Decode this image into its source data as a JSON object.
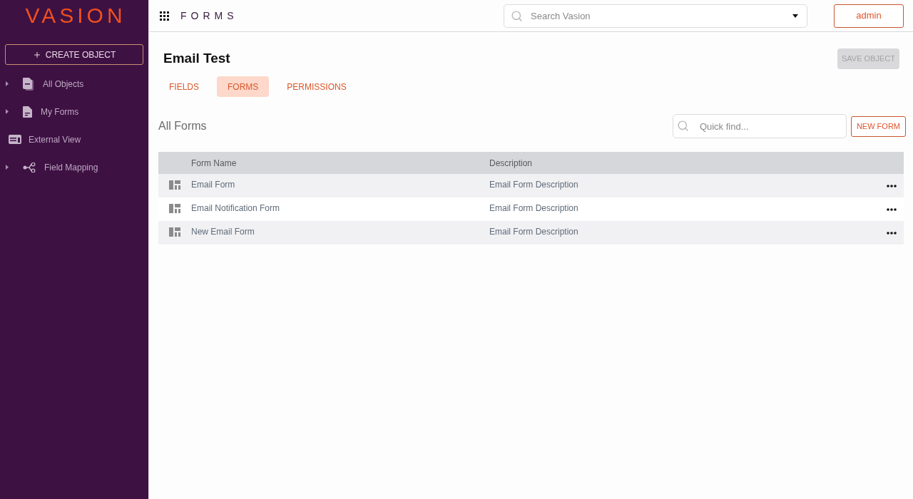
{
  "sidebar": {
    "logo": "VASION",
    "create_button": "CREATE OBJECT",
    "items": [
      {
        "label": "All Objects",
        "expandable": true
      },
      {
        "label": "My Forms",
        "expandable": true
      },
      {
        "label": "External View",
        "expandable": false
      },
      {
        "label": "Field Mapping",
        "expandable": true
      }
    ]
  },
  "header": {
    "app_title": "FORMS",
    "search": {
      "placeholder": "Search Vasion"
    },
    "user_button": "admin"
  },
  "page": {
    "title": "Email Test",
    "save_button": {
      "label": "SAVE OBJECT",
      "disabled": true
    },
    "tabs": [
      {
        "label": "FIELDS",
        "selected": false
      },
      {
        "label": "FORMS",
        "selected": true
      },
      {
        "label": "PERMISSIONS",
        "selected": false
      }
    ]
  },
  "forms_list": {
    "title": "All Forms",
    "quick_find": {
      "placeholder": "Quick find..."
    },
    "new_button": "NEW FORM",
    "table": {
      "columns": [
        "Form Name",
        "Description"
      ],
      "rows": [
        {
          "name": "Email Form",
          "description": "Email Form Description"
        },
        {
          "name": "Email Notification Form",
          "description": "Email Form Description"
        },
        {
          "name": "New Email Form",
          "description": "Email Form Description"
        }
      ]
    }
  }
}
